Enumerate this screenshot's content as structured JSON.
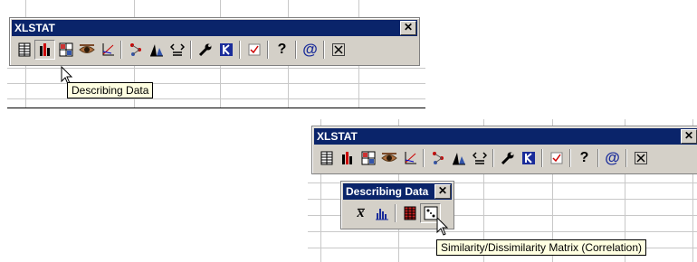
{
  "top_toolbar": {
    "title": "XLSTAT",
    "close_glyph": "✕",
    "icons": [
      {
        "name": "data-table-icon"
      },
      {
        "name": "bar-chart-icon"
      },
      {
        "name": "matrix-grid-icon"
      },
      {
        "name": "eye-icon"
      },
      {
        "name": "scatter-axes-icon"
      },
      {
        "name": "cluster-tree-icon"
      },
      {
        "name": "distribution-icon"
      },
      {
        "name": "compare-signs-icon"
      },
      {
        "name": "wrench-icon"
      },
      {
        "name": "k-icon"
      },
      {
        "name": "checkbox-icon"
      },
      {
        "name": "help-icon"
      },
      {
        "name": "at-icon"
      },
      {
        "name": "close-toolbar-icon"
      }
    ],
    "tooltip": "Describing Data"
  },
  "bottom_toolbar": {
    "title": "XLSTAT",
    "close_glyph": "✕"
  },
  "describing_palette": {
    "title": "Describing Data",
    "close_glyph": "✕",
    "icons": [
      {
        "name": "x-bar-mean-icon",
        "glyph": "x̅"
      },
      {
        "name": "histogram-icon"
      },
      {
        "name": "correlation-grid-icon"
      },
      {
        "name": "similarity-matrix-icon"
      }
    ],
    "tooltip": "Similarity/Dissimilarity Matrix (Correlation)"
  },
  "colors": {
    "titlebar": "#0a246a",
    "toolbar_face": "#d4d0c8",
    "tooltip_bg": "#ffffe1",
    "accent_red": "#cc0000",
    "accent_blue": "#1a2c9a"
  }
}
